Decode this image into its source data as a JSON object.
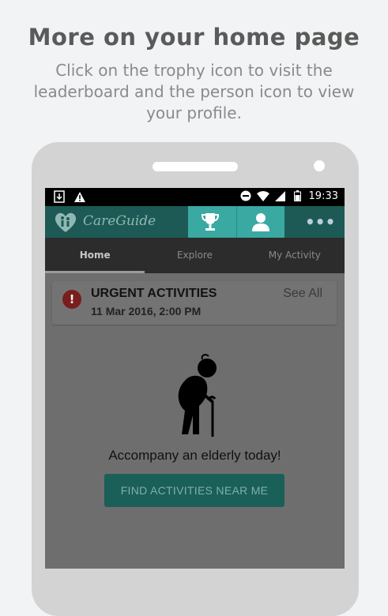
{
  "page": {
    "headline": "More on your home page",
    "subtitle": "Click on the trophy icon to visit the leaderboard and the person icon to view your profile."
  },
  "statusbar": {
    "time": "19:33",
    "left_icons": [
      "download-icon",
      "warning-icon"
    ],
    "right_icons": [
      "dnd-icon",
      "wifi-icon",
      "signal-icon",
      "battery-icon"
    ]
  },
  "appbar": {
    "brand": "CareGuide",
    "icons": [
      "trophy-icon",
      "person-icon",
      "more-icon"
    ],
    "more_label": "•••",
    "colors": {
      "bar": "#1d5a55",
      "highlight": "#3aa9a2"
    }
  },
  "tabs": [
    {
      "label": "Home",
      "active": true
    },
    {
      "label": "Explore",
      "active": false
    },
    {
      "label": "My Activity",
      "active": false
    }
  ],
  "urgent": {
    "title": "URGENT ACTIVITIES",
    "date": "11 Mar 2016, 2:00 PM",
    "see_all": "See All",
    "icon_glyph": "!"
  },
  "main": {
    "illustration": "elderly-person-icon",
    "message": "Accompany an elderly today!",
    "button_label": "FIND ACTIVITIES NEAR ME"
  }
}
